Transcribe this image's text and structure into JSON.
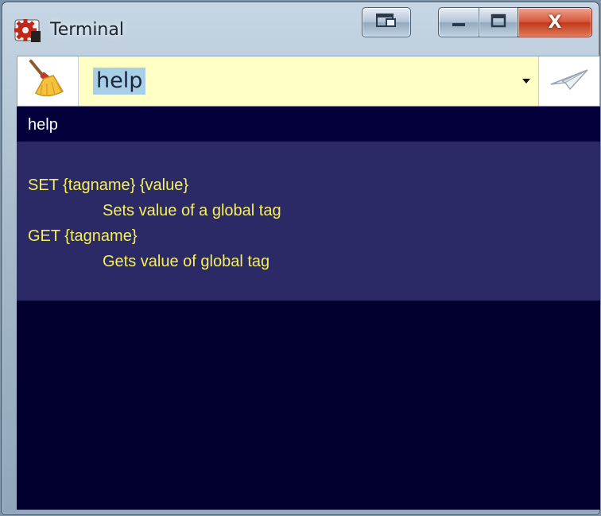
{
  "window": {
    "title": "Terminal",
    "app_icon": "gear-icon",
    "controls": {
      "dock_icon": "dock-window-icon",
      "minimize_icon": "minimize-icon",
      "maximize_icon": "maximize-icon",
      "close_label": "X"
    }
  },
  "toolbar": {
    "clear_icon": "broom-icon",
    "command_value": "help",
    "dropdown_icon": "chevron-down-icon",
    "send_icon": "paper-plane-icon"
  },
  "terminal": {
    "echo": "help",
    "output": [
      "SET {tagname} {value}",
      "Sets value of a global tag",
      "GET {tagname}",
      "Gets value of global tag"
    ],
    "colors": {
      "background": "#02002f",
      "echo_background": "#03003b",
      "output_background": "#2c2a66",
      "output_text": "#f4ef5a",
      "echo_text": "#ffffff"
    }
  }
}
